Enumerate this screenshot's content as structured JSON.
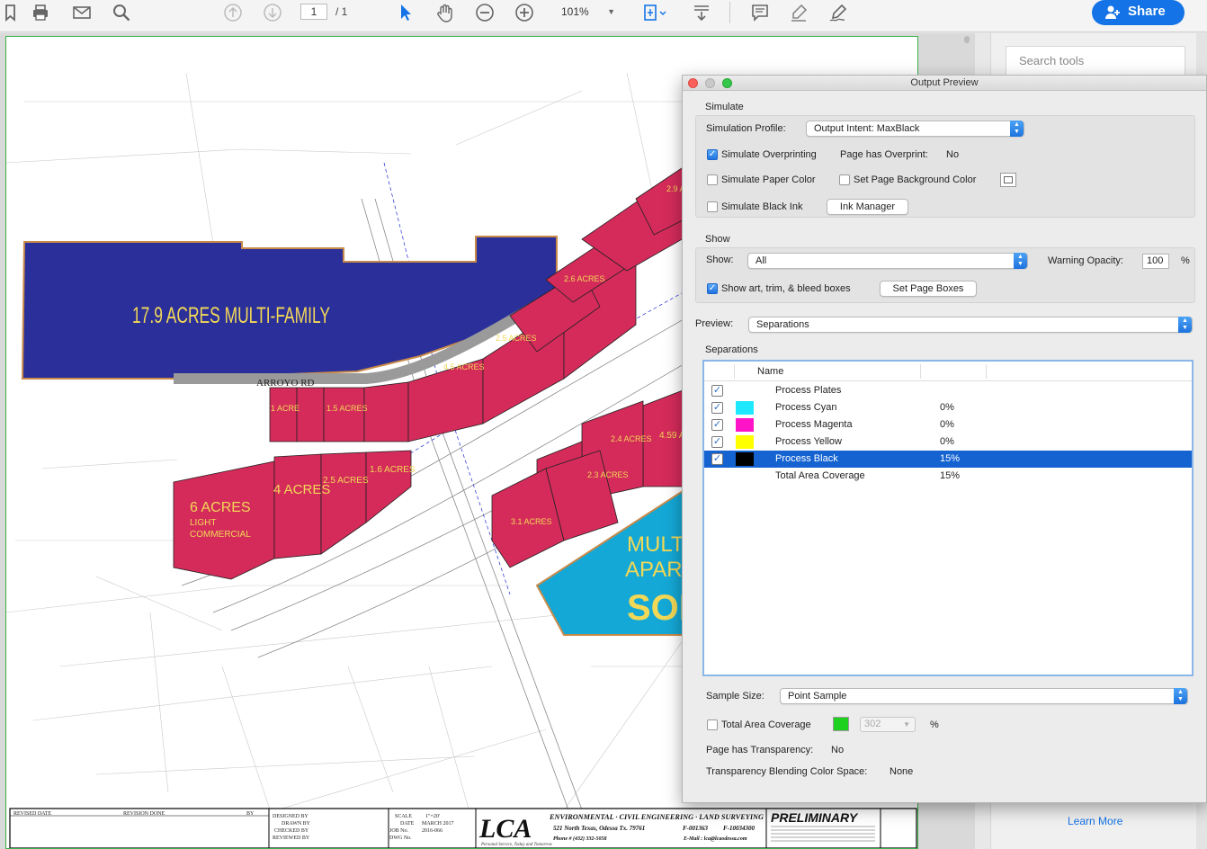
{
  "toolbar": {
    "page_current": "1",
    "page_total": "/ 1",
    "zoom": "101%",
    "share_label": "Share",
    "icons": [
      "bookmark-icon",
      "print-icon",
      "mail-icon",
      "zoom-search-icon",
      "page-up-icon",
      "page-down-icon",
      "select-arrow-icon",
      "hand-icon",
      "zoom-out-icon",
      "zoom-in-icon",
      "fit-page-icon",
      "scroll-mode-icon",
      "comment-icon",
      "highlight-icon",
      "sign-icon"
    ]
  },
  "tools_pane": {
    "search_placeholder": "Search tools",
    "learn_more": "Learn More"
  },
  "document": {
    "parcels": [
      {
        "label": "17.9 ACRES MULTI-FAMILY"
      },
      {
        "label": "ARROYO RD"
      },
      {
        "label": "6 ACRES"
      },
      {
        "label": "LIGHT"
      },
      {
        "label": "COMMERCIAL"
      },
      {
        "label": "4 ACRES"
      },
      {
        "label": "2.5 ACRES"
      },
      {
        "label": "1.6 ACRES"
      },
      {
        "label": "1 ACRE"
      },
      {
        "label": "1.5 ACRES"
      },
      {
        "label": "4.5 ACRES"
      },
      {
        "label": "2.5 ACRES"
      },
      {
        "label": "2.6 ACRES"
      },
      {
        "label": "2.9 AC"
      },
      {
        "label": "4.59 A"
      },
      {
        "label": "2.4 ACRES"
      },
      {
        "label": "2.3 ACRES"
      },
      {
        "label": "3.1 ACRES"
      },
      {
        "label": "MULTI-"
      },
      {
        "label": "APARTM"
      },
      {
        "label": "SOL"
      }
    ],
    "titleblock": {
      "revised_date": "REVISED DATE",
      "revision_done": "REVISION DONE",
      "by": "BY",
      "designed_by": "DESIGNED BY",
      "drawn_by": "DRAWN BY",
      "checked_by": "CHECKED BY",
      "reviewed_by": "REVIEWED BY",
      "scale": "SCALE",
      "scale_val": "1\"=20'",
      "date": "DATE",
      "date_val": "MARCH 2017",
      "job_no": "JOB No.",
      "job_val": "2016-066",
      "dwg_no": "DWG No.",
      "logo": "LCA",
      "company": "ENVIRONMENTAL · CIVIL ENGINEERING · LAND SURVEYING",
      "address": "521 North Texas, Odessa Tx. 79761",
      "firm1": "F-001363",
      "firm2": "F-10034300",
      "phone": "Phone # (432) 332-5058",
      "email": "E-Mail : lca@lcaodessa.com",
      "tagline": "Personal Service, Today and Tomorrow",
      "stamp": "PRELIMINARY"
    }
  },
  "dialog": {
    "title": "Output Preview",
    "simulate_header": "Simulate",
    "sim_profile_label": "Simulation Profile:",
    "sim_profile_value": "Output Intent: MaxBlack",
    "simulate_overprinting": "Simulate Overprinting",
    "page_has_overprint_label": "Page has Overprint:",
    "page_has_overprint_value": "No",
    "simulate_paper_color": "Simulate Paper Color",
    "set_page_bg_color": "Set Page Background Color",
    "simulate_black_ink": "Simulate Black Ink",
    "ink_manager": "Ink Manager",
    "show_header": "Show",
    "show_label": "Show:",
    "show_value": "All",
    "warning_opacity_label": "Warning Opacity:",
    "warning_opacity_value": "100",
    "percent": "%",
    "show_art_boxes": "Show art, trim, & bleed boxes",
    "set_page_boxes": "Set Page Boxes",
    "preview_label": "Preview:",
    "preview_value": "Separations",
    "separations_header": "Separations",
    "col_name": "Name",
    "separations": [
      {
        "name": "Process Plates",
        "pct": "",
        "checked": true,
        "color": ""
      },
      {
        "name": "Process Cyan",
        "pct": "0%",
        "checked": true,
        "color": "#1ee8ff"
      },
      {
        "name": "Process Magenta",
        "pct": "0%",
        "checked": true,
        "color": "#ff14c8"
      },
      {
        "name": "Process Yellow",
        "pct": "0%",
        "checked": true,
        "color": "#ffff00"
      },
      {
        "name": "Process Black",
        "pct": "15%",
        "checked": true,
        "color": "#000000"
      },
      {
        "name": "Total Area Coverage",
        "pct": "15%",
        "checked": false,
        "color": ""
      }
    ],
    "sample_size_label": "Sample Size:",
    "sample_size_value": "Point Sample",
    "total_area_coverage": "Total Area Coverage",
    "tac_value": "302",
    "page_transparency_label": "Page has Transparency:",
    "page_transparency_value": "No",
    "blending_label": "Transparency Blending Color Space:",
    "blending_value": "None"
  }
}
